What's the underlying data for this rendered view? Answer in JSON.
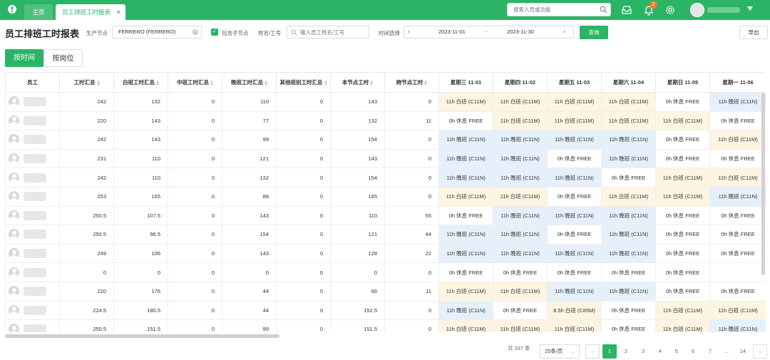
{
  "header": {
    "tabs": [
      {
        "label": "主页"
      },
      {
        "label": "员工排班工时报表"
      }
    ],
    "search_placeholder": "搜索人员或功能",
    "notification_count": "2"
  },
  "toolbar": {
    "title": "员工排班工时报表",
    "node_label": "生产节点",
    "node_value": "FERRERO (FERRERO)",
    "include_children_label": "包含子节点",
    "name_label": "姓名/工号",
    "name_placeholder": "输入员工姓名/工号",
    "time_label": "时间选择",
    "date_start": "2023-11-01",
    "date_sep": "~",
    "date_end": "2023-11-30",
    "query_label": "查询",
    "export_label": "导出"
  },
  "view_tabs": [
    {
      "label": "按时间"
    },
    {
      "label": "按岗位"
    }
  ],
  "table": {
    "columns": [
      "员工",
      "工时汇总",
      "白班工时汇总",
      "中班工时汇总",
      "晚班工时汇总",
      "其他班别工时汇总",
      "本节点工时",
      "跨节点工时",
      "星期三 11-01",
      "星期四 11-02",
      "星期五 11-03",
      "星期六 11-04",
      "星期日 11-05",
      "星期一 11-06"
    ],
    "rows": [
      {
        "total": "242",
        "day": "132",
        "mid": "0",
        "night": "110",
        "other": "0",
        "node": "143",
        "cross": "0",
        "shifts": [
          "11h 白班 (C11M)",
          "11h 白班 (C11M)",
          "11h 白班 (C11M)",
          "11h 白班 (C11M)",
          "0h 休息 FREE",
          "11h 晚班 (C11N)"
        ]
      },
      {
        "total": "220",
        "day": "143",
        "mid": "0",
        "night": "77",
        "other": "0",
        "node": "132",
        "cross": "11",
        "shifts": [
          "0h 休息 FREE",
          "11h 白班 (C11M)",
          "11h 白班 (C11M)",
          "11h 白班 (C11M)",
          "11h 白班 (C11M)",
          "0h 休息 FREE"
        ]
      },
      {
        "total": "242",
        "day": "143",
        "mid": "0",
        "night": "99",
        "other": "0",
        "node": "154",
        "cross": "0",
        "shifts": [
          "11h 晚班 (C11N)",
          "11h 晚班 (C11N)",
          "11h 晚班 (C11N)",
          "11h 晚班 (C11N)",
          "0h 休息 FREE",
          "11h 白班 (C11M)"
        ]
      },
      {
        "total": "231",
        "day": "110",
        "mid": "0",
        "night": "121",
        "other": "0",
        "node": "143",
        "cross": "0",
        "shifts": [
          "11h 晚班 (C11N)",
          "11h 晚班 (C11N)",
          "0h 休息 FREE",
          "11h 晚班 (C11N)",
          "0h 休息 FREE",
          "0h 休息 FREE"
        ]
      },
      {
        "total": "242",
        "day": "110",
        "mid": "0",
        "night": "132",
        "other": "0",
        "node": "154",
        "cross": "0",
        "shifts": [
          "11h 晚班 (C11N)",
          "11h 晚班 (C11N)",
          "11h 晚班 (C11N)",
          "0h 休息 FREE",
          "11h 白班 (C11M)",
          "11h 白班 (C11M)"
        ]
      },
      {
        "total": "253",
        "day": "165",
        "mid": "0",
        "night": "88",
        "other": "0",
        "node": "165",
        "cross": "0",
        "shifts": [
          "11h 白班 (C11M)",
          "11h 白班 (C11M)",
          "0h 休息 FREE",
          "11h 白班 (C11M)",
          "11h 白班 (C11M)",
          "11h 晚班 (C11N)"
        ]
      },
      {
        "total": "250.5",
        "day": "107.5",
        "mid": "0",
        "night": "143",
        "other": "0",
        "node": "110",
        "cross": "55",
        "shifts": [
          "0h 休息 FREE",
          "11h 晚班 (C11N)",
          "11h 晚班 (C11N)",
          "11h 晚班 (C11N)",
          "0h 休息 FREE",
          "0h 休息 FREE"
        ]
      },
      {
        "total": "250.5",
        "day": "96.5",
        "mid": "0",
        "night": "154",
        "other": "0",
        "node": "121",
        "cross": "44",
        "shifts": [
          "11h 晚班 (C11N)",
          "11h 晚班 (C11N)",
          "0h 休息 FREE",
          "11h 晚班 (C11N)",
          "0h 休息 FREE",
          "0h 休息 FREE"
        ]
      },
      {
        "total": "249",
        "day": "106",
        "mid": "0",
        "night": "143",
        "other": "0",
        "node": "128",
        "cross": "22",
        "shifts": [
          "11h 晚班 (C11N)",
          "11h 晚班 (C11N)",
          "11h 晚班 (C11N)",
          "11h 晚班 (C11N)",
          "0h 休息 FREE",
          "0h 休息 FREE"
        ]
      },
      {
        "total": "0",
        "day": "0",
        "mid": "0",
        "night": "0",
        "other": "0",
        "node": "0",
        "cross": "0",
        "shifts": [
          "0h 休息 FREE",
          "0h 休息 FREE",
          "0h 休息 FREE",
          "0h 休息 FREE",
          "0h 休息 FREE",
          ""
        ]
      },
      {
        "total": "220",
        "day": "176",
        "mid": "0",
        "night": "44",
        "other": "0",
        "node": "66",
        "cross": "11",
        "shifts": [
          "11h 白班 (C11M)",
          "11h 白班 (C11M)",
          "11h 晚班 (C11N)",
          "11h 晚班 (C11N)",
          "0h 休息 FREE",
          "0h 休息 FREE"
        ]
      },
      {
        "total": "224.5",
        "day": "180.5",
        "mid": "0",
        "night": "44",
        "other": "0",
        "node": "152.5",
        "cross": "0",
        "shifts": [
          "11h 晚班 (C11N)",
          "0h 休息 FREE",
          "8.5h 白班 (C85M)",
          "0h 休息 FREE",
          "11h 白班 (C11M)",
          "11h 白班 (C11M)"
        ]
      },
      {
        "total": "250.5",
        "day": "151.5",
        "mid": "0",
        "night": "99",
        "other": "0",
        "node": "151.5",
        "cross": "0",
        "shifts": [
          "11h 白班 (C11M)",
          "11h 白班 (C11M)",
          "11h 白班 (C11M)",
          "0h 休息 FREE",
          "11h 白班 (C11M)",
          "11h 晚班 (C11N)"
        ]
      }
    ]
  },
  "pagination": {
    "total_text": "共 337 条",
    "page_size": "25条/页",
    "pages": [
      "1",
      "2",
      "3",
      "4",
      "5",
      "6",
      "7",
      "...",
      "14"
    ],
    "active_page": "1"
  },
  "colors": {
    "brand": "#2bb466",
    "day_shift_bg": "#fdf5e2",
    "night_shift_bg": "#e5f0fb"
  }
}
